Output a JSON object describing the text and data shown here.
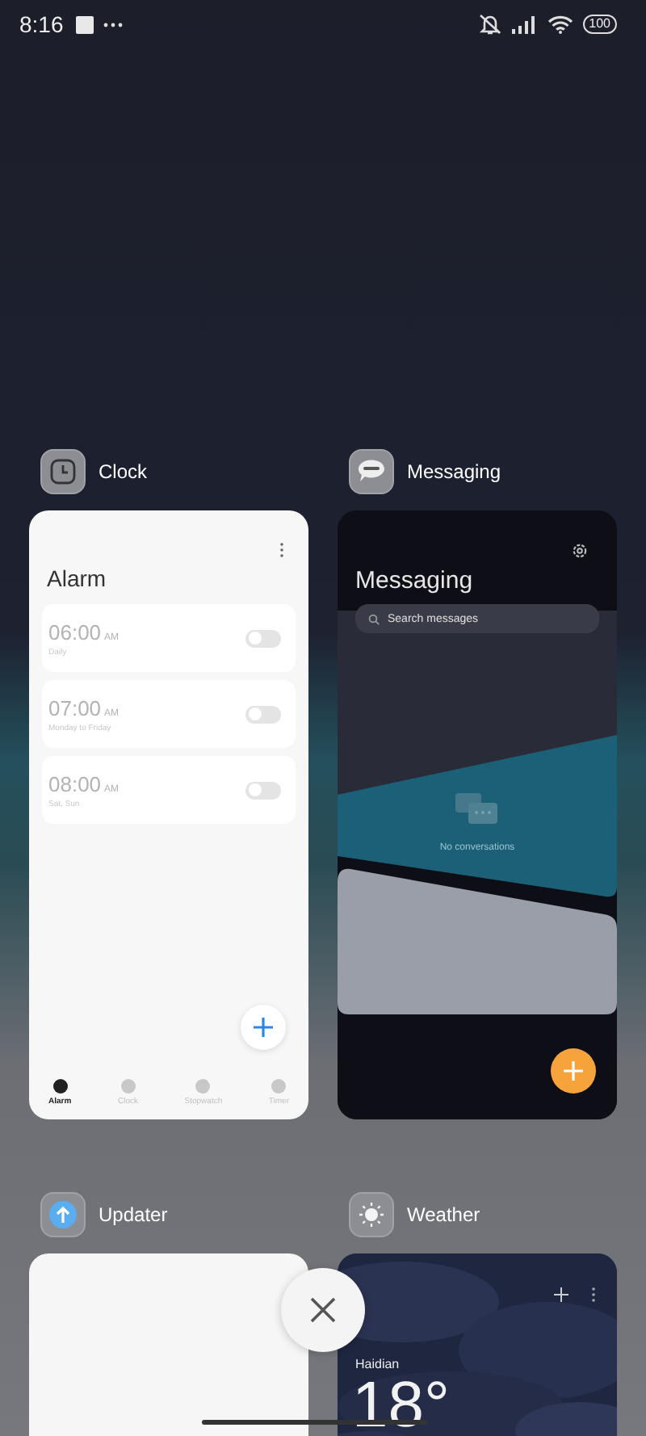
{
  "status_bar": {
    "time": "8:16",
    "battery": "100"
  },
  "apps": [
    {
      "kind": "clock",
      "name": "Clock",
      "title": "Alarm",
      "alarms": [
        {
          "time": "06:00",
          "period": "AM",
          "repeat": "Daily",
          "on": false
        },
        {
          "time": "07:00",
          "period": "AM",
          "repeat": "Monday to Friday",
          "on": false
        },
        {
          "time": "08:00",
          "period": "AM",
          "repeat": "Sat, Sun",
          "on": false
        }
      ],
      "tabs": [
        {
          "label": "Alarm",
          "selected": true
        },
        {
          "label": "Clock",
          "selected": false
        },
        {
          "label": "Stopwatch",
          "selected": false
        },
        {
          "label": "Timer",
          "selected": false
        }
      ]
    },
    {
      "kind": "messaging",
      "name": "Messaging",
      "title": "Messaging",
      "search": {
        "placeholder": "Search messages"
      },
      "empty_text": "No conversations"
    },
    {
      "kind": "updater",
      "name": "Updater"
    },
    {
      "kind": "weather",
      "name": "Weather",
      "location": "Haidian",
      "temperature": "18°"
    }
  ]
}
